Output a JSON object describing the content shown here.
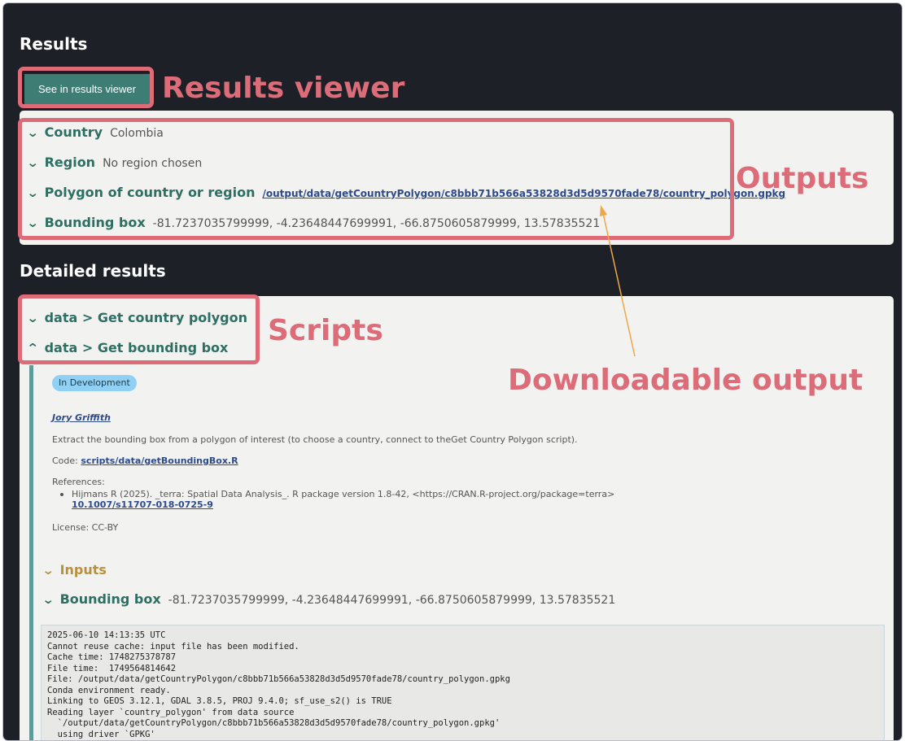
{
  "results": {
    "heading": "Results",
    "viewer_button": "See in results viewer",
    "outputs": [
      {
        "label": "Country",
        "value": "Colombia"
      },
      {
        "label": "Region",
        "value": "No region chosen"
      },
      {
        "label": "Polygon of country or region",
        "value": "/output/data/getCountryPolygon/c8bbb71b566a53828d3d5d9570fade78/country_polygon.gpkg"
      },
      {
        "label": "Bounding box",
        "value": "-81.7237035799999, -4.23648447699991, -66.8750605879999, 13.57835521"
      }
    ]
  },
  "detailed": {
    "heading": "Detailed results",
    "scripts": [
      {
        "label": "data > Get country polygon",
        "expanded": false
      },
      {
        "label": "data > Get bounding box",
        "expanded": true
      }
    ],
    "status_badge": "In Development",
    "author": "Jory Griffith",
    "description": "Extract the bounding box from a polygon of interest (to choose a country, connect to theGet Country Polygon script).",
    "code_prefix": "Code:",
    "code_link": "scripts/data/getBoundingBox.R",
    "references_label": "References:",
    "reference_text": "Hijmans R (2025). _terra: Spatial Data Analysis_. R package version 1.8-42, <https://CRAN.R-project.org/package=terra>",
    "reference_doi": "10.1007/s11707-018-0725-9",
    "license": "License: CC-BY",
    "inputs_label": "Inputs",
    "bbox_label": "Bounding box",
    "bbox_value": "-81.7237035799999, -4.23648447699991, -66.8750605879999, 13.57835521",
    "log_lines": [
      "2025-06-10 14:13:35 UTC",
      "Cannot reuse cache: input file has been modified.",
      "Cache time: 1748275378787",
      "File time:  1749564814642",
      "File: /output/data/getCountryPolygon/c8bbb71b566a53828d3d5d9570fade78/country_polygon.gpkg",
      "Conda environment ready.",
      "Linking to GEOS 3.12.1, GDAL 3.8.5, PROJ 9.4.0; sf_use_s2() is TRUE",
      "Reading layer `country_polygon' from data source",
      "  `/output/data/getCountryPolygon/c8bbb71b566a53828d3d5d9570fade78/country_polygon.gpkg'",
      "  using driver `GPKG'"
    ]
  },
  "annotations": {
    "results_viewer": "Results viewer",
    "outputs": "Outputs",
    "scripts": "Scripts",
    "downloadable_output": "Downloadable output",
    "color": "#dd6c79",
    "arrow_color": "#f0a64a"
  },
  "colors": {
    "background": "#1d2027",
    "panel": "#f2f2f0",
    "teal": "#2e6f64",
    "button": "#3d7d74",
    "gold": "#b8913a",
    "badge": "#8fd0f4",
    "link": "#2d4a8a"
  },
  "icons": {
    "collapsed": "chevron-down-icon",
    "expanded": "chevron-up-icon"
  }
}
